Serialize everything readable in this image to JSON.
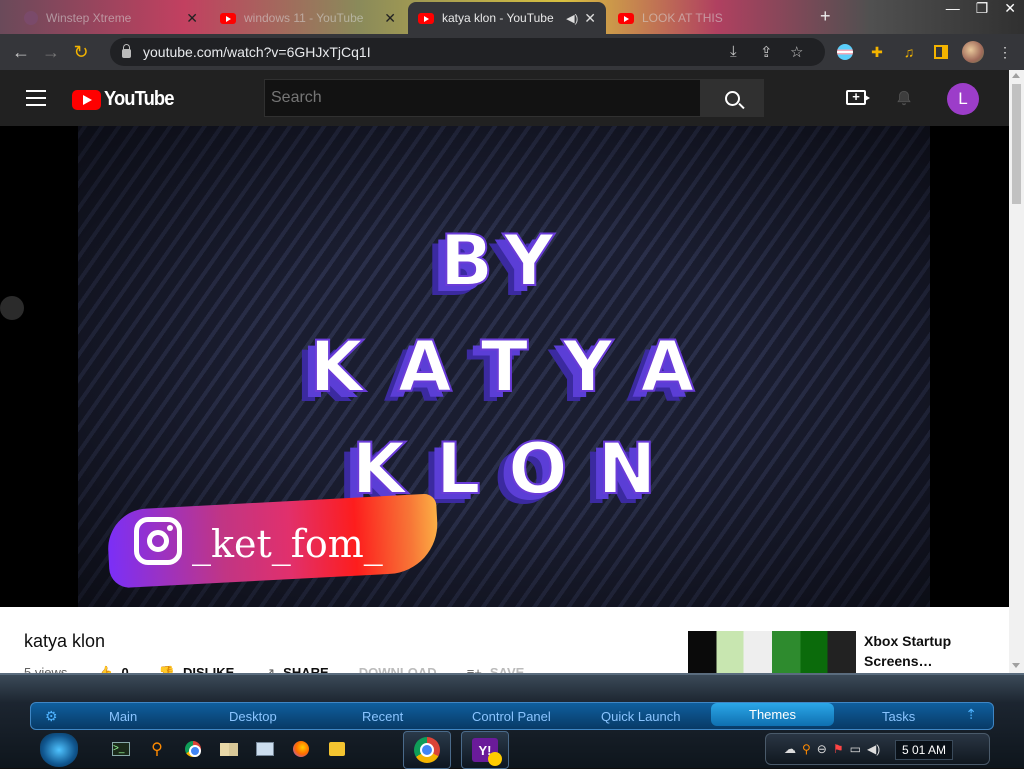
{
  "browser": {
    "tabs": [
      {
        "title": "Winstep Xtreme",
        "favicon": "generic",
        "active": false
      },
      {
        "title": "windows 11 - YouTube",
        "favicon": "youtube",
        "active": false
      },
      {
        "title": "katya klon - YouTube",
        "favicon": "youtube",
        "active": true,
        "audio": true
      },
      {
        "title": "LOOK AT THIS",
        "favicon": "youtube",
        "active": false
      }
    ],
    "new_tab": "+",
    "url": "youtube.com/watch?v=6GHJxTjCq1I"
  },
  "youtube": {
    "logo_text": "YouTube",
    "search_placeholder": "Search",
    "avatar_letter": "L",
    "video": {
      "title_lines": [
        "BY",
        "KATYA",
        "KLON"
      ],
      "instagram_handle": "_ket_fom_"
    },
    "video_title": "katya klon",
    "views": "5 views",
    "actions": {
      "likes": "0",
      "dislike": "DISLIKE",
      "share": "SHARE",
      "download": "DOWNLOAD",
      "save": "SAVE"
    },
    "recommended": [
      {
        "title": "Xbox Startup Screens…"
      }
    ]
  },
  "taskbar": {
    "menu": [
      "Main",
      "Desktop",
      "Recent",
      "Control Panel",
      "Quick Launch",
      "Themes",
      "Tasks"
    ],
    "active_menu": "Themes",
    "clock": "5 01 AM"
  },
  "colors": {
    "youtube_red": "#ff0000",
    "avatar_purple": "#9c3dc9",
    "taskbar_accent": "#2ba7e8"
  }
}
